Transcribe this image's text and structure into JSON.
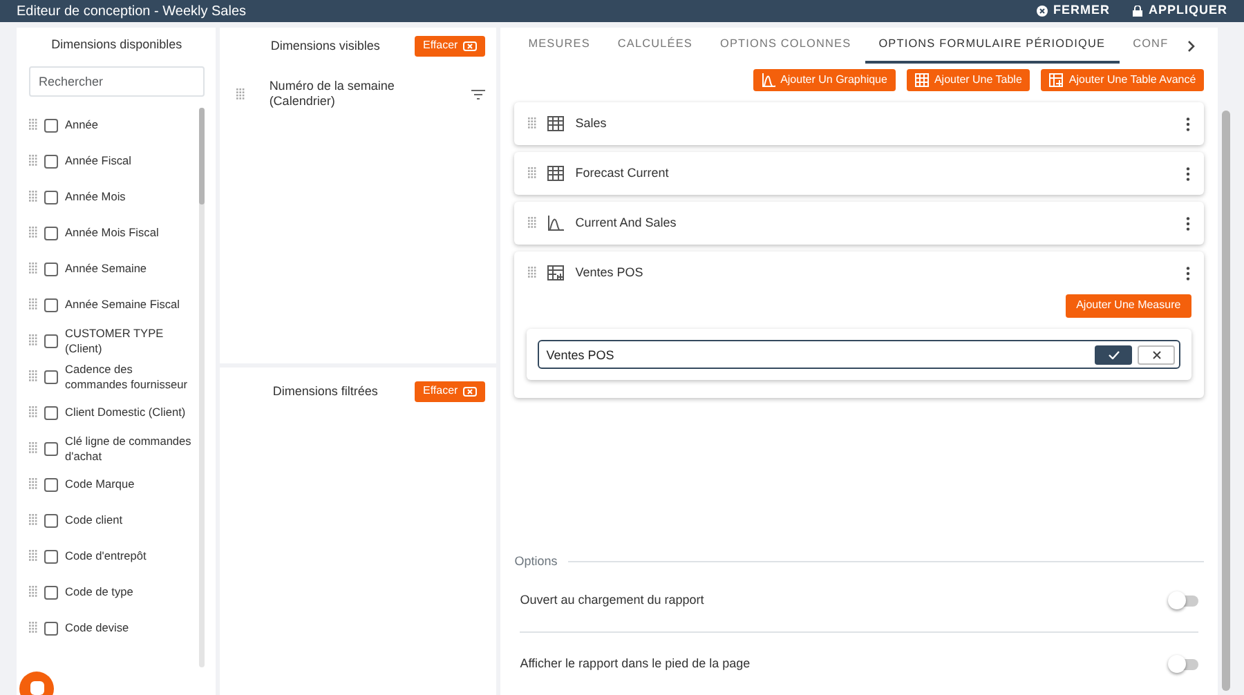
{
  "window": {
    "title": "Editeur de conception - Weekly Sales",
    "actions": [
      "FERMER",
      "APPLIQUER"
    ]
  },
  "available": {
    "title": "Dimensions disponibles",
    "search": {
      "placeholder": "Rechercher"
    },
    "items": [
      {
        "label": "Année",
        "checked": false
      },
      {
        "label": "Année Fiscal",
        "checked": false
      },
      {
        "label": "Année Mois",
        "checked": false
      },
      {
        "label": "Année Mois Fiscal",
        "checked": false
      },
      {
        "label": "Année Semaine",
        "checked": false
      },
      {
        "label": "Année Semaine Fiscal",
        "checked": false
      },
      {
        "label": "CUSTOMER TYPE (Client)",
        "checked": false
      },
      {
        "label": "Cadence des commandes fournisseur",
        "checked": false
      },
      {
        "label": "Client Domestic (Client)",
        "checked": false
      },
      {
        "label": "Clé ligne de commandes d'achat",
        "checked": false
      },
      {
        "label": "Code Marque",
        "checked": false
      },
      {
        "label": "Code client",
        "checked": false
      },
      {
        "label": "Code d'entrepôt",
        "checked": false
      },
      {
        "label": "Code de type",
        "checked": false
      },
      {
        "label": "Code devise",
        "checked": false
      }
    ]
  },
  "visible": {
    "title": "Dimensions visibles",
    "clear": "Effacer",
    "items": [
      {
        "label": "Numéro de la semaine (Calendrier)"
      }
    ]
  },
  "filtered": {
    "title": "Dimensions filtrées",
    "clear": "Effacer"
  },
  "tabs": [
    {
      "label": "MESURES",
      "selected": false
    },
    {
      "label": "CALCULÉES",
      "selected": false
    },
    {
      "label": "OPTIONS COLONNES",
      "selected": false
    },
    {
      "label": "OPTIONS FORMULAIRE PÉRIODIQUE",
      "selected": true
    },
    {
      "label": "CONF",
      "selected": false
    }
  ],
  "add_buttons": [
    {
      "kind": "chart",
      "label": "Ajouter Un Graphique"
    },
    {
      "kind": "table",
      "label": "Ajouter Une Table"
    },
    {
      "kind": "advanced",
      "label": "Ajouter Une Table Avancé"
    }
  ],
  "widgets": [
    {
      "kind": "table",
      "title": "Sales",
      "expanded": false
    },
    {
      "kind": "table",
      "title": "Forecast Current",
      "expanded": false
    },
    {
      "kind": "chart",
      "title": "Current And Sales",
      "expanded": false
    },
    {
      "kind": "advanced",
      "title": "Ventes POS",
      "expanded": true,
      "add_measure": "Ajouter Une Measure",
      "edit_value": "Ventes POS"
    }
  ],
  "options": {
    "title": "Options",
    "toggles": [
      {
        "label": "Ouvert au chargement du rapport",
        "on": false
      },
      {
        "label": "Afficher le rapport dans le pied de la page",
        "on": false
      }
    ]
  }
}
